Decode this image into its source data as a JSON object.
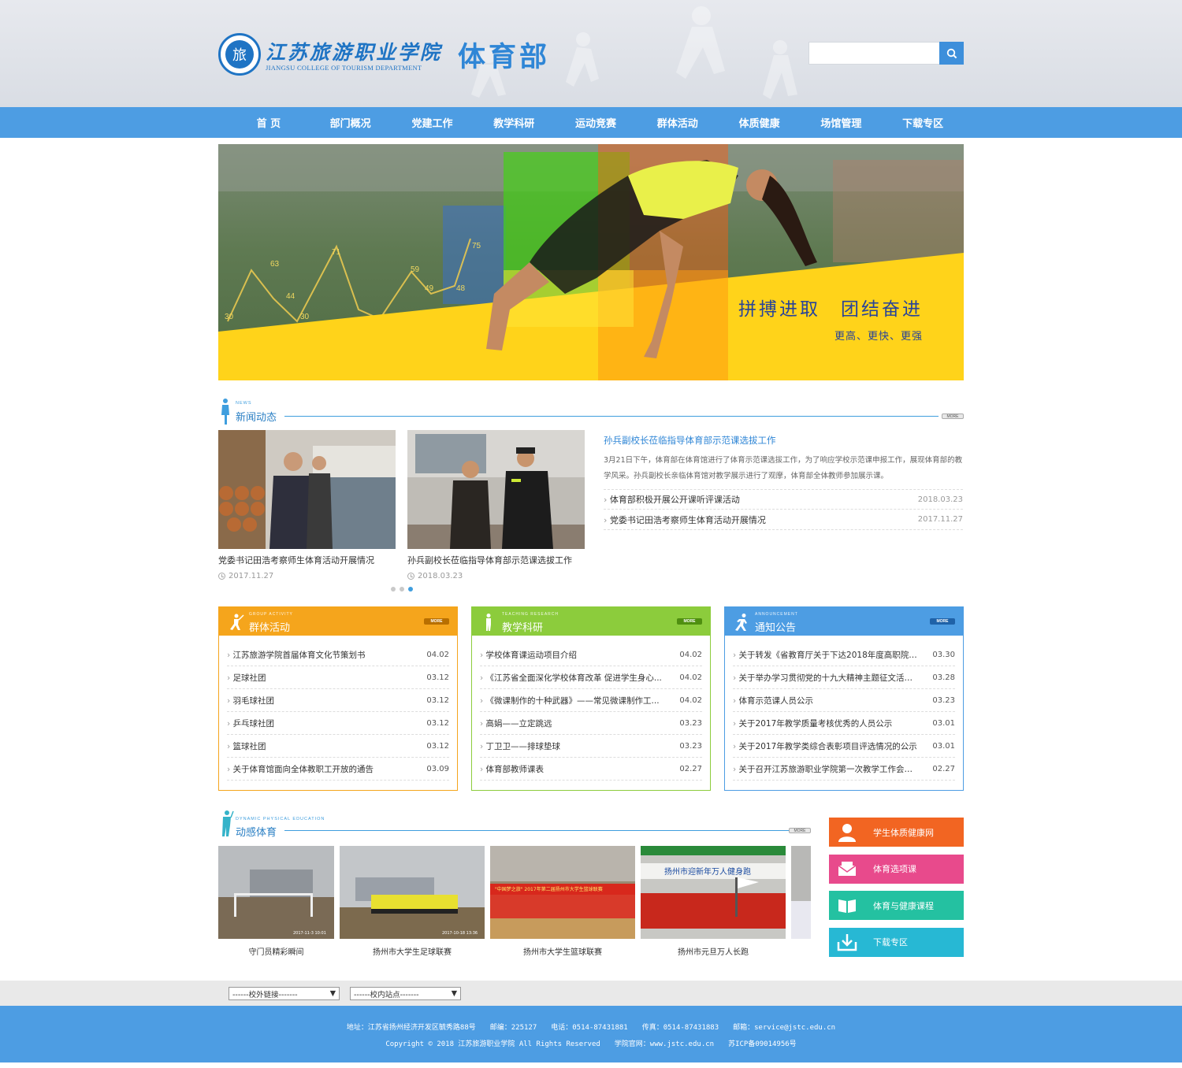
{
  "header": {
    "logo_cn": "江苏旅游职业学院",
    "logo_en": "JIANGSU COLLEGE OF TOURISM DEPARTMENT",
    "dept": "体育部",
    "search_placeholder": "",
    "search_icon": "search-icon"
  },
  "nav": {
    "items": [
      "首 页",
      "部门概况",
      "党建工作",
      "教学科研",
      "运动竞赛",
      "群体活动",
      "体质健康",
      "场馆管理",
      "下载专区"
    ]
  },
  "banner": {
    "slogan": "拼搏进取　团结奋进",
    "sub": "更高、更快、更强",
    "chart_values": [
      "30",
      "63",
      "44",
      "30",
      "71",
      "59",
      "49",
      "48",
      "75"
    ]
  },
  "news": {
    "en": "NEWS",
    "title": "新闻动态",
    "more": "MORE",
    "cards": [
      {
        "caption": "党委书记田浩考察师生体育活动开展情况",
        "date": "2017.11.27"
      },
      {
        "caption": "孙兵副校长莅临指导体育部示范课选拔工作",
        "date": "2018.03.23"
      }
    ],
    "featured": {
      "title": "孙兵副校长莅临指导体育部示范课选拔工作",
      "desc": "3月21日下午，体育部在体育馆进行了体育示范课选拔工作，为了响应学校示范课申报工作，展现体育部的教学风采。孙兵副校长亲临体育馆对教学展示进行了观摩，体育部全体教师参加展示课。"
    },
    "list": [
      {
        "title": "体育部积极开展公开课听评课活动",
        "date": "2018.03.23"
      },
      {
        "title": "党委书记田浩考察师生体育活动开展情况",
        "date": "2017.11.27"
      }
    ]
  },
  "cols": [
    {
      "en": "GROUP ACTIVITY",
      "title": "群体活动",
      "more": "MORE",
      "items": [
        {
          "t": "江苏旅游学院首届体育文化节策划书",
          "d": "04.02"
        },
        {
          "t": "足球社团",
          "d": "03.12"
        },
        {
          "t": "羽毛球社团",
          "d": "03.12"
        },
        {
          "t": "乒乓球社团",
          "d": "03.12"
        },
        {
          "t": "篮球社团",
          "d": "03.12"
        },
        {
          "t": "关于体育馆面向全体教职工开放的通告",
          "d": "03.09"
        }
      ]
    },
    {
      "en": "TEACHING RESEARCH",
      "title": "教学科研",
      "more": "MORE",
      "items": [
        {
          "t": "学校体育课运动项目介绍",
          "d": "04.02"
        },
        {
          "t": "《江苏省全面深化学校体育改革 促进学生身心...",
          "d": "04.02"
        },
        {
          "t": "《微课制作的十种武器》——常见微课制作工...",
          "d": "04.02"
        },
        {
          "t": "高娟——立定跳远",
          "d": "03.23"
        },
        {
          "t": "丁卫卫——排球垫球",
          "d": "03.23"
        },
        {
          "t": "体育部教师课表",
          "d": "02.27"
        }
      ]
    },
    {
      "en": "ANNOUNCEMENT",
      "title": "通知公告",
      "more": "MORE",
      "items": [
        {
          "t": "关于转发《省教育厅关于下达2018年度高职院校...",
          "d": "03.30"
        },
        {
          "t": "关于举办学习贯彻党的十九大精神主题征文活动...",
          "d": "03.28"
        },
        {
          "t": "体育示范课人员公示",
          "d": "03.23"
        },
        {
          "t": "关于2017年教学质量考核优秀的人员公示",
          "d": "03.01"
        },
        {
          "t": "关于2017年教学类综合表彰项目评选情况的公示",
          "d": "03.01"
        },
        {
          "t": "关于召开江苏旅游职业学院第一次教学工作会议...",
          "d": "02.27"
        }
      ]
    }
  ],
  "dynamic": {
    "en": "DYNAMIC PHYSICAL EDUCATION",
    "title": "动感体育",
    "more": "MORE",
    "photos": [
      {
        "caption": "守门员精彩瞬间",
        "stamp": "2017-11-3 10:01"
      },
      {
        "caption": "扬州市大学生足球联赛",
        "stamp": "2017-10-18 13:36"
      },
      {
        "caption": "扬州市大学生篮球联赛",
        "stamp": "",
        "banner": "\"中国梦之旅\" 2017年第二届扬州市大学生篮球联赛"
      },
      {
        "caption": "扬州市元旦万人长跑",
        "stamp": "",
        "banner": "扬州市迎新年万人健身跑"
      }
    ]
  },
  "quick": [
    {
      "label": "学生体质健康网",
      "color": "#f26522",
      "icon": "user-icon"
    },
    {
      "label": "体育选项课",
      "color": "#e84a8c",
      "icon": "envelope-icon"
    },
    {
      "label": "体育与健康课程",
      "color": "#24c1a1",
      "icon": "book-icon"
    },
    {
      "label": "下载专区",
      "color": "#27b8d4",
      "icon": "download-icon"
    }
  ],
  "links": {
    "outer": "------校外链接-------",
    "inner": "------校内站点-------",
    "arrow": "▼"
  },
  "footer": {
    "line1": "地址：江苏省扬州经济开发区毓秀路88号　　邮编：225127　　电话：0514-87431881　　传真：0514-87431883　　邮箱：service@jstc.edu.cn",
    "line2": "Copyright © 2018 江苏旅游职业学院 All Rights Reserved　　学院官网：www.jstc.edu.cn　　苏ICP备09014956号"
  }
}
